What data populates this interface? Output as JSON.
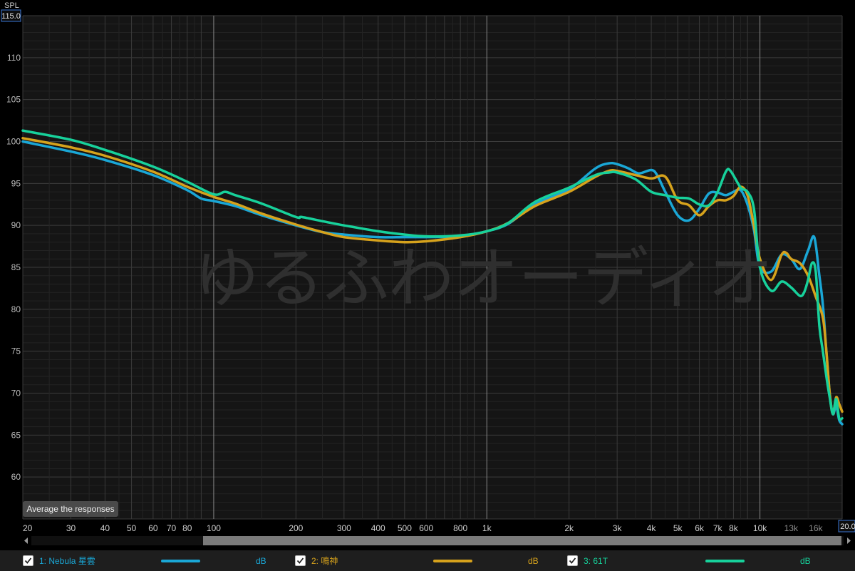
{
  "chart_data": {
    "type": "line",
    "ylabel": "SPL",
    "ylim": [
      55,
      115
    ],
    "y_top_readout": "115.0",
    "x_right_readout": "20.0",
    "xlim": [
      20,
      20000
    ],
    "x_scale": "log",
    "grid": true,
    "y_ticks": [
      60,
      65,
      70,
      75,
      80,
      85,
      90,
      95,
      100,
      105,
      110
    ],
    "x_ticks": [
      {
        "value": 20,
        "label": "20"
      },
      {
        "value": 30,
        "label": "30"
      },
      {
        "value": 40,
        "label": "40"
      },
      {
        "value": 50,
        "label": "50"
      },
      {
        "value": 60,
        "label": "60"
      },
      {
        "value": 70,
        "label": "70"
      },
      {
        "value": 80,
        "label": "80"
      },
      {
        "value": 100,
        "label": "100"
      },
      {
        "value": 200,
        "label": "200"
      },
      {
        "value": 300,
        "label": "300"
      },
      {
        "value": 400,
        "label": "400"
      },
      {
        "value": 500,
        "label": "500"
      },
      {
        "value": 600,
        "label": "600"
      },
      {
        "value": 800,
        "label": "800"
      },
      {
        "value": 1000,
        "label": "1k"
      },
      {
        "value": 2000,
        "label": "2k"
      },
      {
        "value": 3000,
        "label": "3k"
      },
      {
        "value": 4000,
        "label": "4k"
      },
      {
        "value": 5000,
        "label": "5k"
      },
      {
        "value": 6000,
        "label": "6k"
      },
      {
        "value": 7000,
        "label": "7k"
      },
      {
        "value": 8000,
        "label": "8k"
      },
      {
        "value": 10000,
        "label": "10k"
      },
      {
        "value": 13000,
        "label": "13k",
        "dim": true
      },
      {
        "value": 16000,
        "label": "16k",
        "dim": true
      }
    ],
    "series": [
      {
        "name": "1: Nebula 星雲",
        "color": "#1aa7d6",
        "points": [
          [
            20,
            100.0
          ],
          [
            30,
            98.8
          ],
          [
            40,
            97.8
          ],
          [
            60,
            96.0
          ],
          [
            80,
            94.2
          ],
          [
            90,
            93.2
          ],
          [
            100,
            92.9
          ],
          [
            120,
            92.3
          ],
          [
            150,
            91.2
          ],
          [
            200,
            90.0
          ],
          [
            250,
            89.2
          ],
          [
            300,
            88.9
          ],
          [
            400,
            88.6
          ],
          [
            500,
            88.6
          ],
          [
            600,
            88.6
          ],
          [
            800,
            88.7
          ],
          [
            1000,
            89.3
          ],
          [
            1200,
            90.2
          ],
          [
            1500,
            92.5
          ],
          [
            2000,
            94.3
          ],
          [
            2500,
            96.8
          ],
          [
            2800,
            97.4
          ],
          [
            3000,
            97.3
          ],
          [
            3300,
            96.8
          ],
          [
            3600,
            96.2
          ],
          [
            4000,
            96.6
          ],
          [
            4200,
            96.0
          ],
          [
            4500,
            94.0
          ],
          [
            5000,
            91.2
          ],
          [
            5500,
            90.6
          ],
          [
            6000,
            92.0
          ],
          [
            6500,
            93.8
          ],
          [
            7000,
            93.9
          ],
          [
            7500,
            93.6
          ],
          [
            8000,
            94.0
          ],
          [
            8500,
            94.2
          ],
          [
            9000,
            92.5
          ],
          [
            9500,
            89.5
          ],
          [
            10000,
            85.0
          ],
          [
            11000,
            84.5
          ],
          [
            12000,
            86.5
          ],
          [
            13000,
            86.0
          ],
          [
            14000,
            84.8
          ],
          [
            15000,
            87.0
          ],
          [
            15800,
            88.6
          ],
          [
            16500,
            84.0
          ],
          [
            17000,
            80.5
          ],
          [
            17500,
            75.0
          ],
          [
            18000,
            70.0
          ],
          [
            18500,
            67.5
          ],
          [
            19000,
            68.5
          ],
          [
            19500,
            66.8
          ],
          [
            20000,
            66.3
          ]
        ]
      },
      {
        "name": "2: 鳴神",
        "color": "#d6a21c",
        "points": [
          [
            20,
            100.4
          ],
          [
            30,
            99.3
          ],
          [
            40,
            98.3
          ],
          [
            60,
            96.4
          ],
          [
            80,
            94.6
          ],
          [
            100,
            93.4
          ],
          [
            120,
            92.6
          ],
          [
            150,
            91.4
          ],
          [
            200,
            90.1
          ],
          [
            250,
            89.2
          ],
          [
            300,
            88.6
          ],
          [
            400,
            88.2
          ],
          [
            500,
            88.0
          ],
          [
            600,
            88.1
          ],
          [
            800,
            88.6
          ],
          [
            1000,
            89.3
          ],
          [
            1200,
            90.3
          ],
          [
            1500,
            92.3
          ],
          [
            2000,
            94.0
          ],
          [
            2500,
            95.8
          ],
          [
            2800,
            96.5
          ],
          [
            3000,
            96.5
          ],
          [
            3500,
            96.0
          ],
          [
            4000,
            95.6
          ],
          [
            4500,
            95.8
          ],
          [
            5000,
            93.0
          ],
          [
            5500,
            92.4
          ],
          [
            6000,
            91.2
          ],
          [
            6500,
            92.3
          ],
          [
            7000,
            93.0
          ],
          [
            7500,
            93.0
          ],
          [
            8000,
            93.5
          ],
          [
            8500,
            94.6
          ],
          [
            9000,
            93.6
          ],
          [
            9500,
            90.0
          ],
          [
            10000,
            86.0
          ],
          [
            11000,
            83.5
          ],
          [
            12000,
            86.5
          ],
          [
            12500,
            86.7
          ],
          [
            13000,
            86.0
          ],
          [
            14000,
            85.5
          ],
          [
            15000,
            84.0
          ],
          [
            16000,
            81.5
          ],
          [
            17000,
            79.0
          ],
          [
            17500,
            75.0
          ],
          [
            18000,
            70.0
          ],
          [
            18500,
            67.5
          ],
          [
            19000,
            69.5
          ],
          [
            19500,
            68.7
          ],
          [
            20000,
            67.8
          ]
        ]
      },
      {
        "name": "3: 61T",
        "color": "#17d19b",
        "points": [
          [
            20,
            101.3
          ],
          [
            30,
            100.2
          ],
          [
            40,
            99.0
          ],
          [
            60,
            97.0
          ],
          [
            80,
            95.2
          ],
          [
            100,
            93.7
          ],
          [
            110,
            94.0
          ],
          [
            120,
            93.6
          ],
          [
            150,
            92.6
          ],
          [
            200,
            91.0
          ],
          [
            210,
            91.0
          ],
          [
            250,
            90.5
          ],
          [
            300,
            90.0
          ],
          [
            400,
            89.3
          ],
          [
            500,
            88.9
          ],
          [
            600,
            88.7
          ],
          [
            800,
            88.8
          ],
          [
            1000,
            89.3
          ],
          [
            1200,
            90.3
          ],
          [
            1500,
            92.8
          ],
          [
            2000,
            94.5
          ],
          [
            2500,
            96.0
          ],
          [
            2800,
            96.3
          ],
          [
            3000,
            96.3
          ],
          [
            3500,
            95.5
          ],
          [
            4000,
            94.0
          ],
          [
            4500,
            93.6
          ],
          [
            5000,
            93.3
          ],
          [
            5500,
            93.2
          ],
          [
            6000,
            92.5
          ],
          [
            6500,
            92.4
          ],
          [
            7000,
            94.0
          ],
          [
            7500,
            96.4
          ],
          [
            7800,
            96.5
          ],
          [
            8500,
            94.5
          ],
          [
            9000,
            94.0
          ],
          [
            9500,
            92.0
          ],
          [
            10000,
            85.0
          ],
          [
            11000,
            82.2
          ],
          [
            12000,
            83.3
          ],
          [
            13000,
            82.6
          ],
          [
            14000,
            81.6
          ],
          [
            14500,
            82.0
          ],
          [
            15000,
            83.5
          ],
          [
            15500,
            85.5
          ],
          [
            16000,
            84.5
          ],
          [
            16500,
            78.0
          ],
          [
            17000,
            75.0
          ],
          [
            17500,
            72.0
          ],
          [
            18000,
            69.5
          ],
          [
            18500,
            67.5
          ],
          [
            19000,
            69.3
          ],
          [
            19500,
            67.0
          ],
          [
            20000,
            67.0
          ]
        ]
      }
    ]
  },
  "legend": [
    {
      "label": "1: Nebula 星雲",
      "unit": "dB",
      "color": "#1aa7d6",
      "checked": true
    },
    {
      "label": "2: 鳴神",
      "unit": "dB",
      "color": "#d6a21c",
      "checked": true
    },
    {
      "label": "3: 61T",
      "unit": "dB",
      "color": "#17d19b",
      "checked": true
    }
  ],
  "controls": {
    "average_button": "Average the responses"
  },
  "watermark": "ゆるふわオーディオ"
}
